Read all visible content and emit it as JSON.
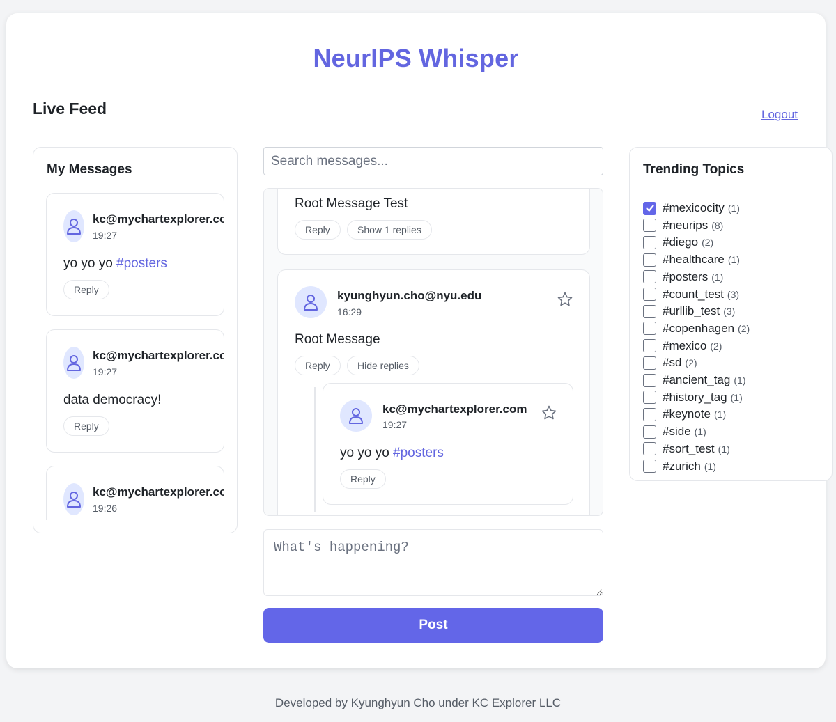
{
  "app": {
    "title": "NeurIPS Whisper"
  },
  "header": {
    "feed_title": "Live Feed",
    "logout_label": "Logout"
  },
  "my_messages": {
    "title": "My Messages",
    "items": [
      {
        "author": "kc@mychartexplorer.com",
        "time": "19:27",
        "text": "yo yo yo ",
        "hashtag": "#posters",
        "reply_label": "Reply"
      },
      {
        "author": "kc@mychartexplorer.com",
        "time": "19:27",
        "text": "data democracy!",
        "hashtag": "",
        "reply_label": "Reply"
      },
      {
        "author": "kc@mychartexplorer.com",
        "time": "19:26",
        "text": "",
        "hashtag": "",
        "reply_label": "Reply"
      }
    ]
  },
  "search": {
    "placeholder": "Search messages..."
  },
  "feed": {
    "items": [
      {
        "text": "Root Message Test",
        "reply_label": "Reply",
        "toggle_label": "Show 1 replies"
      },
      {
        "author": "kyunghyun.cho@nyu.edu",
        "time": "16:29",
        "text": "Root Message",
        "reply_label": "Reply",
        "toggle_label": "Hide replies",
        "replies": [
          {
            "author": "kc@mychartexplorer.com",
            "time": "19:27",
            "text": "yo yo yo ",
            "hashtag": "#posters",
            "reply_label": "Reply"
          }
        ]
      }
    ]
  },
  "compose": {
    "placeholder": "What's happening?",
    "post_label": "Post"
  },
  "trending": {
    "title": "Trending Topics",
    "topics": [
      {
        "name": "#mexicocity",
        "count": "(1)",
        "checked": true
      },
      {
        "name": "#neurips",
        "count": "(8)",
        "checked": false
      },
      {
        "name": "#diego",
        "count": "(2)",
        "checked": false
      },
      {
        "name": "#healthcare",
        "count": "(1)",
        "checked": false
      },
      {
        "name": "#posters",
        "count": "(1)",
        "checked": false
      },
      {
        "name": "#count_test",
        "count": "(3)",
        "checked": false
      },
      {
        "name": "#urllib_test",
        "count": "(3)",
        "checked": false
      },
      {
        "name": "#copenhagen",
        "count": "(2)",
        "checked": false
      },
      {
        "name": "#mexico",
        "count": "(2)",
        "checked": false
      },
      {
        "name": "#sd",
        "count": "(2)",
        "checked": false
      },
      {
        "name": "#ancient_tag",
        "count": "(1)",
        "checked": false
      },
      {
        "name": "#history_tag",
        "count": "(1)",
        "checked": false
      },
      {
        "name": "#keynote",
        "count": "(1)",
        "checked": false
      },
      {
        "name": "#side",
        "count": "(1)",
        "checked": false
      },
      {
        "name": "#sort_test",
        "count": "(1)",
        "checked": false
      },
      {
        "name": "#zurich",
        "count": "(1)",
        "checked": false
      }
    ]
  },
  "footer": {
    "text": "Developed by Kyunghyun Cho under KC Explorer LLC"
  },
  "colors": {
    "accent": "#6366e0",
    "button": "#6366e8",
    "avatar_bg": "#e0e7ff",
    "border": "#e5e7eb"
  }
}
